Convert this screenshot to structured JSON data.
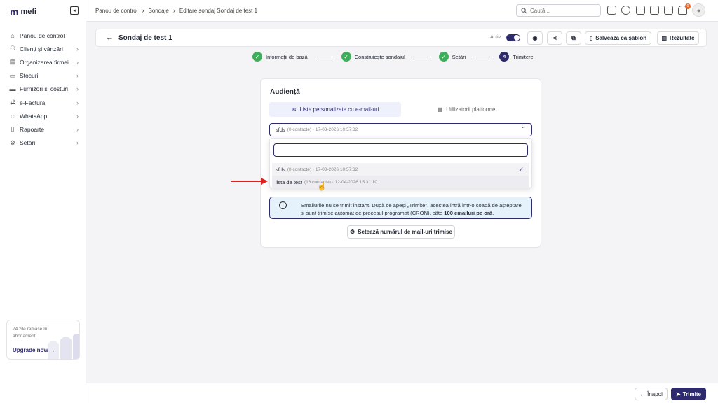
{
  "app": {
    "logo_mark": "m",
    "name": "mefi"
  },
  "sidebar": {
    "items": [
      {
        "label": "Panou de control",
        "icon": "home-icon",
        "has_chevron": false
      },
      {
        "label": "Clienți și vânzări",
        "icon": "users-icon",
        "has_chevron": true
      },
      {
        "label": "Organizarea firmei",
        "icon": "org-icon",
        "has_chevron": true
      },
      {
        "label": "Stocuri",
        "icon": "box-icon",
        "has_chevron": true
      },
      {
        "label": "Furnizori și costuri",
        "icon": "wallet-icon",
        "has_chevron": true
      },
      {
        "label": "e-Factura",
        "icon": "invoice-icon",
        "has_chevron": true
      },
      {
        "label": "WhatsApp",
        "icon": "whatsapp-icon",
        "has_chevron": true
      },
      {
        "label": "Rapoarte",
        "icon": "clipboard-icon",
        "has_chevron": true
      },
      {
        "label": "Setări",
        "icon": "gear-icon",
        "has_chevron": true
      }
    ],
    "upgrade": {
      "text": "74 zile rămase în abonament",
      "button": "Upgrade now →"
    }
  },
  "topbar": {
    "breadcrumbs": [
      "Panou de control",
      "Sondaje",
      "Editare sondaj Sondaj de test 1"
    ],
    "search_placeholder": "Caută...",
    "notification_count": "0"
  },
  "header": {
    "title": "Sondaj de test 1",
    "active_label": "Activ",
    "active": true,
    "save_template": "Salvează ca șablon",
    "results": "Rezultate"
  },
  "stepper": {
    "steps": [
      {
        "label": "Informații de bază",
        "mark": "✓",
        "state": "done"
      },
      {
        "label": "Construiește sondajul",
        "mark": "✓",
        "state": "done"
      },
      {
        "label": "Setări",
        "mark": "✓",
        "state": "done"
      },
      {
        "label": "Trimitere",
        "mark": "4",
        "state": "current"
      }
    ]
  },
  "audience": {
    "title": "Audiență",
    "tab_lists": "Liste personalizate cu e-mail-uri",
    "tab_platform": "Utilizatorii platformei",
    "selected_name": "sfds",
    "selected_meta": "(0 contacte) · 17-03-2026 10:57:32",
    "dropdown_search_value": "",
    "options": [
      {
        "name": "sfds",
        "meta": "(0 contacte) · 17-03-2026 10:57:32",
        "selected": true
      },
      {
        "name": "lista de test",
        "meta": "(16 contacte) · 12-04-2026 15:31:10",
        "selected": false
      }
    ],
    "info_text_1": "Emailurile nu se trimit instant. După ce apeși „Trimite\", acestea intră într-o coadă de așteptare și sunt trimise automat de procesul programat (CRON), câte ",
    "info_bold": "100 emailuri pe oră",
    "info_text_2": ".",
    "set_count_button": "Setează numărul de mail-uri trimise"
  },
  "footer": {
    "back": "Înapoi",
    "send": "Trimite"
  },
  "colors": {
    "accent": "#2d2a6e",
    "success": "#3fae5a",
    "annotation_red": "#e02020",
    "info_bg": "#e6f2fb"
  }
}
